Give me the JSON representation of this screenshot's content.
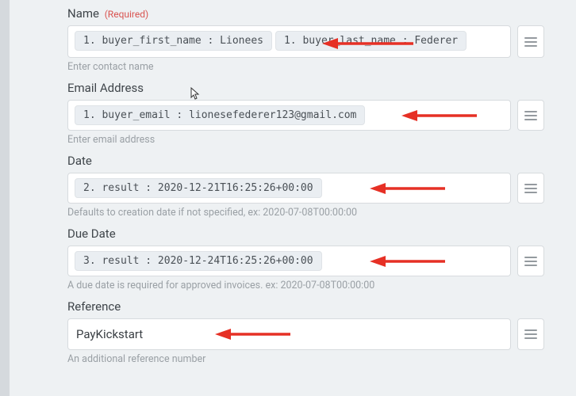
{
  "fields": {
    "name": {
      "label": "Name",
      "required_text": "(Required)",
      "chips": [
        "1. buyer_first_name : Lionees",
        "1. buyer_last_name : Federer"
      ],
      "helper": "Enter contact name"
    },
    "email": {
      "label": "Email Address",
      "chips": [
        "1. buyer_email : lionesefederer123@gmail.com"
      ],
      "helper": "Enter email address"
    },
    "date": {
      "label": "Date",
      "chips": [
        "2. result : 2020-12-21T16:25:26+00:00"
      ],
      "helper": "Defaults to creation date if not specified, ex: 2020-07-08T00:00:00"
    },
    "due_date": {
      "label": "Due Date",
      "chips": [
        "3. result : 2020-12-24T16:25:26+00:00"
      ],
      "helper": "A due date is required for approved invoices. ex: 2020-07-08T00:00:00"
    },
    "reference": {
      "label": "Reference",
      "value": "PayKickstart",
      "helper": "An additional reference number"
    }
  },
  "colors": {
    "arrow": "#e63025",
    "chip_bg": "#eaeef2",
    "border": "#d7dbde"
  }
}
